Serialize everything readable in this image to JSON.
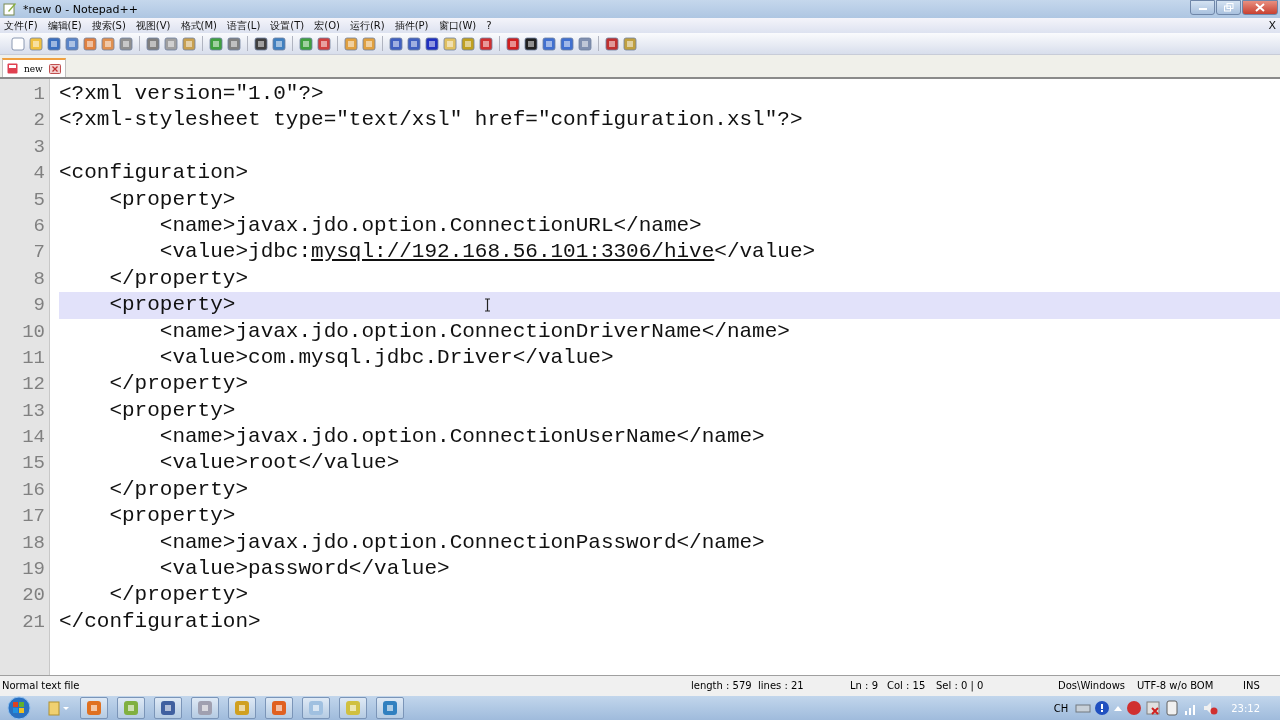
{
  "window": {
    "title": "*new  0 - Notepad++"
  },
  "menu": [
    "文件(F)",
    "编辑(E)",
    "搜索(S)",
    "视图(V)",
    "格式(M)",
    "语言(L)",
    "设置(T)",
    "宏(O)",
    "运行(R)",
    "插件(P)",
    "窗口(W)",
    "?"
  ],
  "menu_close": "X",
  "tabs": [
    {
      "label": "new",
      "selected": true
    }
  ],
  "editor": {
    "lines": [
      {
        "number": "1",
        "text": "<?xml version=\"1.0\"?>",
        "current": false
      },
      {
        "number": "2",
        "text": "<?xml-stylesheet type=\"text/xsl\" href=\"configuration.xsl\"?>",
        "current": false
      },
      {
        "number": "3",
        "current": false
      },
      {
        "number": "4",
        "text": "<configuration>",
        "current": false
      },
      {
        "number": "5",
        "text": "    <property>",
        "current": false
      },
      {
        "number": "6",
        "text": "        <name>javax.jdo.option.ConnectionURL</name>",
        "current": false
      },
      {
        "number": "7",
        "text": "        <value>jdbc:",
        "link": "mysql://192.168.56.101:3306/hive",
        "after": "</value>",
        "current": false
      },
      {
        "number": "8",
        "text": "    </property>",
        "current": false
      },
      {
        "number": "9",
        "text": "    <property>",
        "current": true
      },
      {
        "number": "10",
        "text": "        <name>javax.jdo.option.ConnectionDriverName</name>",
        "current": false
      },
      {
        "number": "11",
        "text": "        <value>com.mysql.jdbc.Driver</value>",
        "current": false
      },
      {
        "number": "12",
        "text": "    </property>",
        "current": false
      },
      {
        "number": "13",
        "text": "    <property>",
        "current": false
      },
      {
        "number": "14",
        "text": "        <name>javax.jdo.option.ConnectionUserName</name>",
        "current": false
      },
      {
        "number": "15",
        "text": "        <value>root</value>",
        "current": false
      },
      {
        "number": "16",
        "text": "    </property>",
        "current": false
      },
      {
        "number": "17",
        "text": "    <property>",
        "current": false
      },
      {
        "number": "18",
        "text": "        <name>javax.jdo.option.ConnectionPassword</name>",
        "current": false
      },
      {
        "number": "19",
        "text": "        <value>password</value>",
        "current": false
      },
      {
        "number": "20",
        "text": "    </property>",
        "current": false
      },
      {
        "number": "21",
        "text": "</configuration>",
        "current": false
      }
    ]
  },
  "status_bar": {
    "file_type": "Normal text file",
    "length": "length : 579",
    "lines": "lines : 21",
    "ln": "Ln : 9",
    "col": "Col : 15",
    "sel": "Sel : 0 | 0",
    "eol": "Dos\\Windows",
    "encoding": "UTF-8 w/o BOM",
    "mode": "INS"
  },
  "taskbar": {
    "tray_language": "CH",
    "clock": "23:12"
  }
}
